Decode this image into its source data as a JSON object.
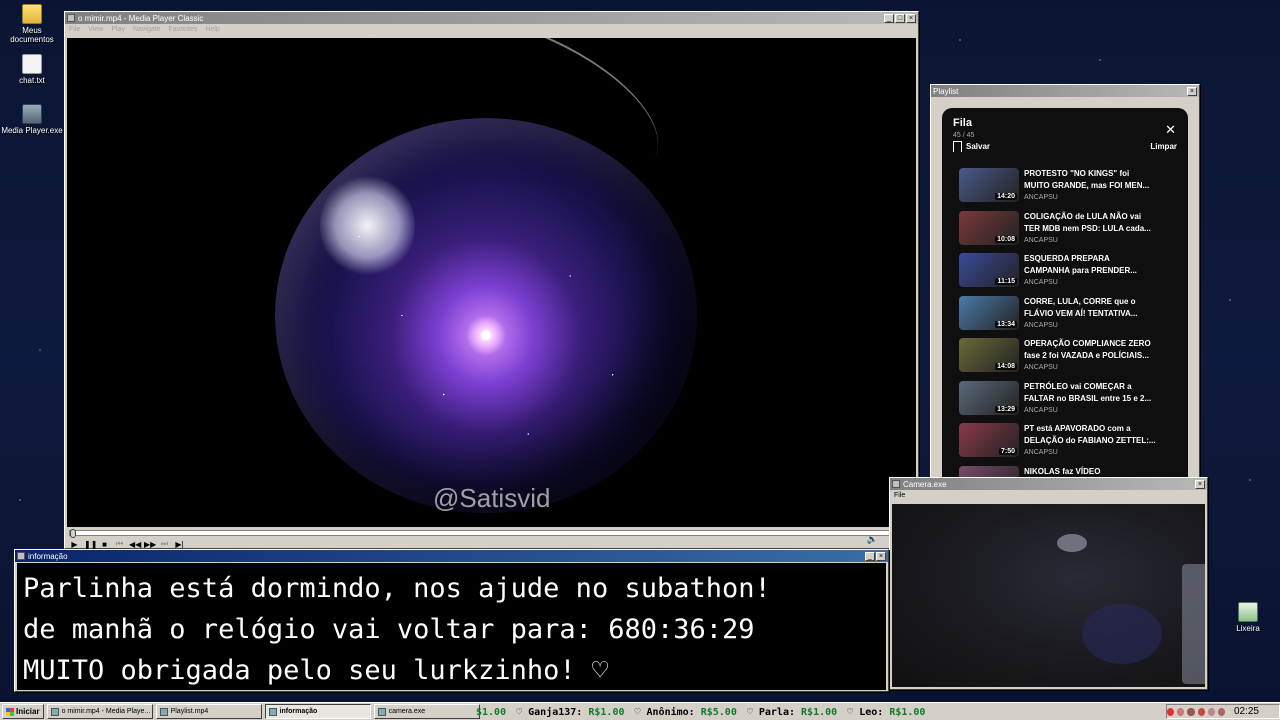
{
  "desktop": {
    "icons": [
      {
        "label": "Meus documentos",
        "icon": "folder-icon"
      },
      {
        "label": "chat.txt",
        "icon": "text-file-icon"
      },
      {
        "label": "Media Player.exe",
        "icon": "media-player-icon"
      },
      {
        "label": "Lixeira",
        "icon": "recycle-bin-icon"
      }
    ]
  },
  "mpc": {
    "title": "o mimir.mp4 - Media Player Classic",
    "menu": [
      "File",
      "View",
      "Play",
      "Navigate",
      "Favorites",
      "Help"
    ],
    "watermark": "@Satisvid"
  },
  "playlist": {
    "window_title": "Playlist",
    "heading": "Fila",
    "count": "45 / 45",
    "save_label": "Salvar",
    "clear_label": "Limpar",
    "items": [
      {
        "line1": "PROTESTO \"NO KINGS\" foi",
        "line2": "MUITO GRANDE, mas FOI MEN...",
        "channel": "ANCAPSU",
        "duration": "14:20",
        "color": "#4a5a8a"
      },
      {
        "line1": "COLIGAÇÃO de LULA NÃO vai",
        "line2": "TER MDB nem PSD: LULA cada...",
        "channel": "ANCAPSU",
        "duration": "10:08",
        "color": "#7a3a3a"
      },
      {
        "line1": "ESQUERDA PREPARA",
        "line2": "CAMPANHA para PRENDER...",
        "channel": "ANCAPSU",
        "duration": "11:15",
        "color": "#3a4a9a"
      },
      {
        "line1": "CORRE, LULA, CORRE que o",
        "line2": "FLÁVIO VEM AÍ! TENTATIVA...",
        "channel": "ANCAPSU",
        "duration": "13:34",
        "color": "#4a7aaa"
      },
      {
        "line1": "OPERAÇÃO COMPLIANCE ZERO",
        "line2": "fase 2 foi VAZADA e POLÍCIAIS...",
        "channel": "ANCAPSU",
        "duration": "14:08",
        "color": "#6a6a3a"
      },
      {
        "line1": "PETRÓLEO vai COMEÇAR a",
        "line2": "FALTAR no BRASIL entre 15 e 2...",
        "channel": "ANCAPSU",
        "duration": "13:29",
        "color": "#5a6a7a"
      },
      {
        "line1": "PT está APAVORADO com a",
        "line2": "DELAÇÃO do FABIANO ZETTEL:...",
        "channel": "ANCAPSU",
        "duration": "7:50",
        "color": "#8a3a4a"
      },
      {
        "line1": "NIKOLAS faz VÍDEO",
        "line2": "",
        "channel": "",
        "duration": "",
        "color": "#7a4a6a"
      }
    ]
  },
  "info": {
    "title": "informação",
    "line1": "Parlinha está dormindo, nos ajude no subathon!",
    "line2": "de manhã o relógio vai voltar para:  680:36:29",
    "line3": "MUITO obrigada pelo seu lurkzinho! ♡"
  },
  "camera": {
    "title": "Camera.exe",
    "menu": "File"
  },
  "taskbar": {
    "start_label": "Iniciar",
    "tasks": [
      {
        "label": "o mimir.mp4 - Media Playe...",
        "pressed": false
      },
      {
        "label": "Playlist.mp4",
        "pressed": false
      },
      {
        "label": "informação",
        "pressed": true
      },
      {
        "label": "camera.exe",
        "pressed": false
      }
    ],
    "ticker": [
      {
        "name": "",
        "amount": "$1.00"
      },
      {
        "name": "Ganja137:",
        "amount": "R$1.00"
      },
      {
        "name": "Anônimo:",
        "amount": "R$5.00"
      },
      {
        "name": "Parla:",
        "amount": "R$1.00"
      },
      {
        "name": "Leo:",
        "amount": "R$1.00"
      }
    ],
    "clock": "02:25"
  }
}
